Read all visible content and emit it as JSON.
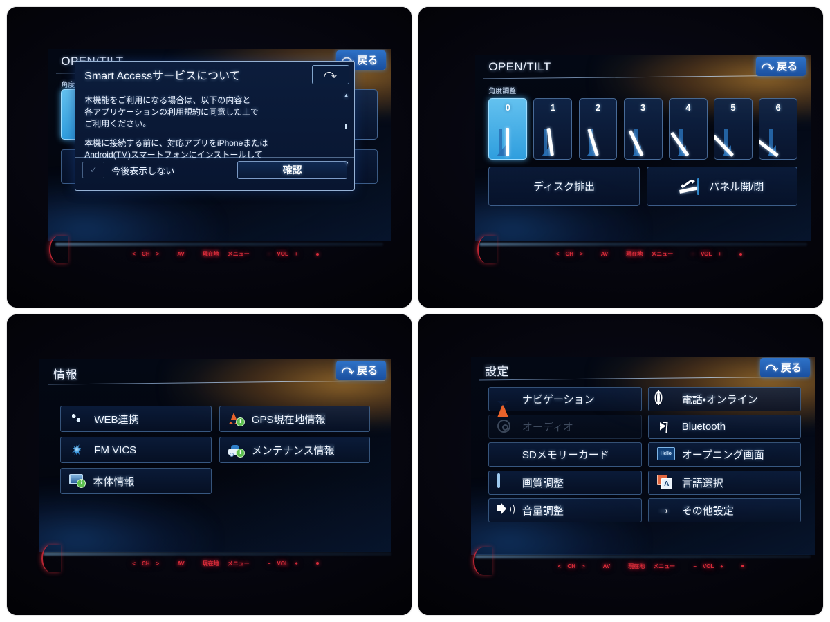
{
  "panels": [
    {
      "id": "open-tilt-dialog",
      "header": {
        "title": "OPEN/TILT",
        "back_label": "戻る",
        "back_icon": "back-arrow-icon"
      },
      "sublabel": "角度調整",
      "dialog": {
        "title": "Smart Accessサービスについて",
        "close_icon": "back-arrow-icon",
        "paragraphs": [
          "本機能をご利用になる場合は、以下の内容と\n各アプリケーションの利用規約に同意した上で\nご利用ください。",
          "本機に接続する前に、対応アプリをiPhoneまたは\nAndroid(TM)スマートフォンにインストールして"
        ],
        "scroll_up_icon": "chevron-up-icon",
        "scroll_down_icon": "chevron-down-icon",
        "checkbox_label": "今後表示しない",
        "checkbox_checked": false,
        "confirm_label": "確認"
      },
      "hw_bar": {
        "prev": "<",
        "ch": "CH",
        "next": ">",
        "av": "AV",
        "current": "現在地",
        "menu": "メニュー",
        "vol_minus": "−",
        "vol": "VOL",
        "vol_plus": "+",
        "power": "●"
      }
    },
    {
      "id": "open-tilt",
      "header": {
        "title": "OPEN/TILT",
        "back_label": "戻る",
        "back_icon": "back-arrow-icon"
      },
      "sublabel": "角度調整",
      "tilt_levels": [
        "0",
        "1",
        "2",
        "3",
        "4",
        "5",
        "6"
      ],
      "tilt_selected": 0,
      "tilt_angles": [
        0,
        8,
        17,
        26,
        35,
        44,
        53
      ],
      "actions": [
        {
          "label": "ディスク排出",
          "icon": ""
        },
        {
          "label": "パネル開/閉",
          "icon": "panel-open-close-icon"
        }
      ],
      "hw_bar": {
        "prev": "<",
        "ch": "CH",
        "next": ">",
        "av": "AV",
        "current": "現在地",
        "menu": "メニュー",
        "vol_minus": "−",
        "vol": "VOL",
        "vol_plus": "+",
        "power": "●"
      }
    },
    {
      "id": "information",
      "header": {
        "title": "情報",
        "back_label": "戻る",
        "back_icon": "back-arrow-icon"
      },
      "menu_items": [
        {
          "label": "WEB連携",
          "icon": "web-globe-icon",
          "disabled": false
        },
        {
          "label": "GPS現在地情報",
          "icon": "gps-arrow-info-icon",
          "disabled": false
        },
        {
          "label": "FM VICS",
          "icon": "vics-star-icon",
          "disabled": false
        },
        {
          "label": "メンテナンス情報",
          "icon": "car-info-icon",
          "disabled": false
        },
        {
          "label": "本体情報",
          "icon": "monitor-info-icon",
          "disabled": false
        },
        {
          "label": "",
          "icon": "",
          "disabled": false,
          "empty": true
        }
      ],
      "hw_bar": {
        "prev": "<",
        "ch": "CH",
        "next": ">",
        "av": "AV",
        "current": "現在地",
        "menu": "メニュー",
        "vol_minus": "−",
        "vol": "VOL",
        "vol_plus": "+",
        "power": "●"
      }
    },
    {
      "id": "settings",
      "header": {
        "title": "設定",
        "back_label": "戻る",
        "back_icon": "back-arrow-icon"
      },
      "menu_items": [
        {
          "label": "ナビゲーション",
          "icon": "navigation-arrow-icon",
          "disabled": false
        },
        {
          "label": "電話・オンライン",
          "icon": "globe-icon",
          "disabled": false
        },
        {
          "label": "オーディオ",
          "icon": "audio-disc-icon",
          "disabled": true
        },
        {
          "label": "Bluetooth",
          "icon": "bluetooth-icon",
          "disabled": false
        },
        {
          "label": "SDメモリーカード",
          "icon": "sd-card-icon",
          "disabled": false
        },
        {
          "label": "オープニング画面",
          "icon": "hello-screen-icon",
          "disabled": false
        },
        {
          "label": "画質調整",
          "icon": "picture-quality-icon",
          "disabled": false
        },
        {
          "label": "言語選択",
          "icon": "language-card-icon",
          "disabled": false
        },
        {
          "label": "音量調整",
          "icon": "speaker-icon",
          "disabled": false
        },
        {
          "label": "その他設定",
          "icon": "right-arrow-icon",
          "disabled": false
        }
      ],
      "hello_icon_text": "Hello",
      "hw_bar": {
        "prev": "<",
        "ch": "CH",
        "next": ">",
        "av": "AV",
        "current": "現在地",
        "menu": "メニュー",
        "vol_minus": "−",
        "vol": "VOL",
        "vol_plus": "+",
        "power": "●"
      }
    }
  ],
  "colors": {
    "accent_blue": "#2f9ede",
    "selected_blue": "#63c1ef",
    "hw_red": "#d82c3a",
    "glare_orange": "#ffb03c",
    "nav_orange": "#e8622a",
    "bg_white": "#ffffff",
    "screen_dark": "#03060f"
  }
}
